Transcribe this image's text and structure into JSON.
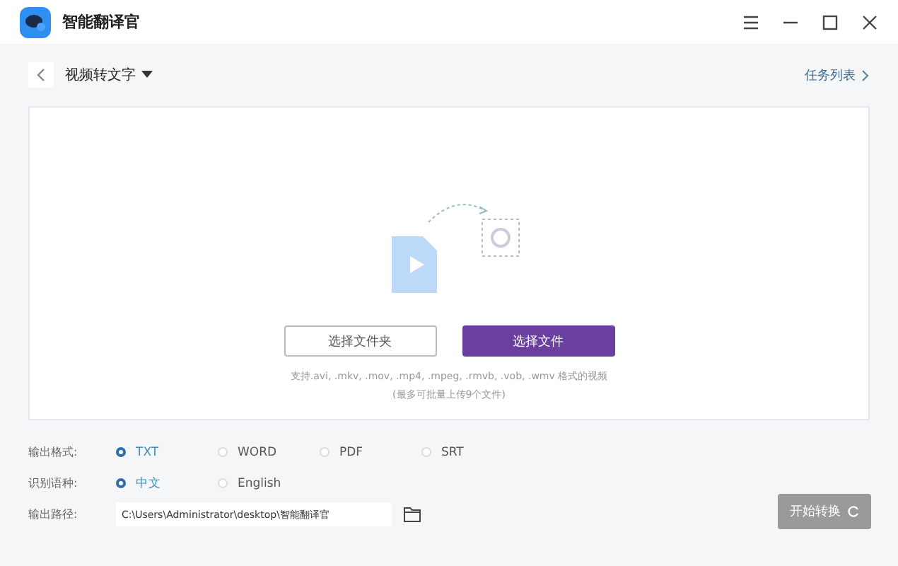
{
  "window": {
    "title": "智能翻译官"
  },
  "header": {
    "title": "视频转文字",
    "task_link": "任务列表"
  },
  "upload": {
    "buttons": [
      {
        "label": "选择文件夹",
        "kind": "outline"
      },
      {
        "label": "选择文件",
        "kind": "primary"
      }
    ],
    "formats_note": "支持.avi, .mkv, .mov, .mp4, .mpeg, .rmvb, .vob, .wmv 格式的视频",
    "limit_note": "(最多可批量上传9个文件)"
  },
  "options": [
    {
      "label": "输出格式:",
      "choices": [
        {
          "label": "TXT",
          "selected": true
        },
        {
          "label": "WORD",
          "selected": false
        },
        {
          "label": "PDF",
          "selected": false
        },
        {
          "label": "SRT",
          "selected": false
        }
      ]
    },
    {
      "label": "识别语种:",
      "choices": [
        {
          "label": "中文",
          "selected": true
        },
        {
          "label": "English",
          "selected": false
        }
      ]
    }
  ],
  "output_path": {
    "label": "输出路径:",
    "value": "C:\\Users\\Administrator\\desktop\\智能翻译官"
  },
  "start_button": {
    "label": "开始转换",
    "disabled": true
  }
}
